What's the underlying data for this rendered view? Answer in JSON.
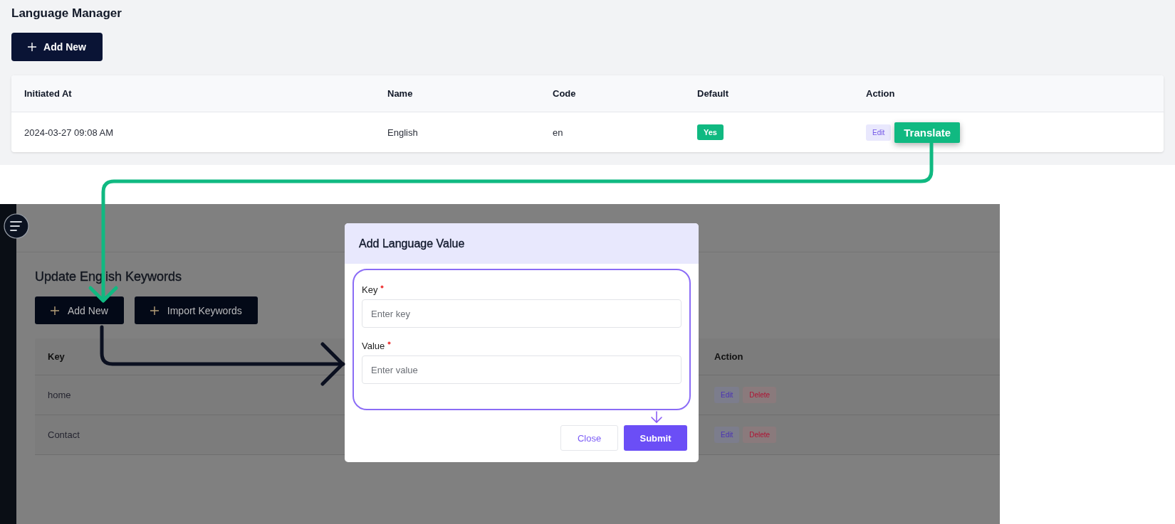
{
  "language_manager": {
    "title": "Language Manager",
    "add_button": "Add New",
    "columns": [
      "Initiated At",
      "Name",
      "Code",
      "Default",
      "Action"
    ],
    "rows": [
      {
        "initiated_at": "2024-03-27 09:08 AM",
        "name": "English",
        "code": "en",
        "default": "Yes",
        "actions": [
          {
            "label": "Edit",
            "kind": "edit"
          },
          {
            "label": "Translate",
            "kind": "translate"
          }
        ]
      }
    ]
  },
  "keywords_page": {
    "title": "Update English Keywords",
    "buttons": [
      "Add New",
      "Import Keywords"
    ],
    "columns": [
      "Key",
      "Action"
    ],
    "rows": [
      {
        "key": "home",
        "actions": [
          {
            "label": "Edit",
            "kind": "edit"
          },
          {
            "label": "Delete",
            "kind": "delete"
          }
        ]
      },
      {
        "key": "Contact",
        "actions": [
          {
            "label": "Edit",
            "kind": "edit"
          },
          {
            "label": "Delete",
            "kind": "delete"
          }
        ]
      }
    ]
  },
  "modal": {
    "title": "Add Language Value",
    "fields": [
      {
        "label": "Key",
        "required": true,
        "placeholder": "Enter key"
      },
      {
        "label": "Value",
        "required": true,
        "placeholder": "Enter value"
      }
    ],
    "buttons": [
      {
        "label": "Close",
        "kind": "secondary"
      },
      {
        "label": "Submit",
        "kind": "primary"
      }
    ]
  }
}
